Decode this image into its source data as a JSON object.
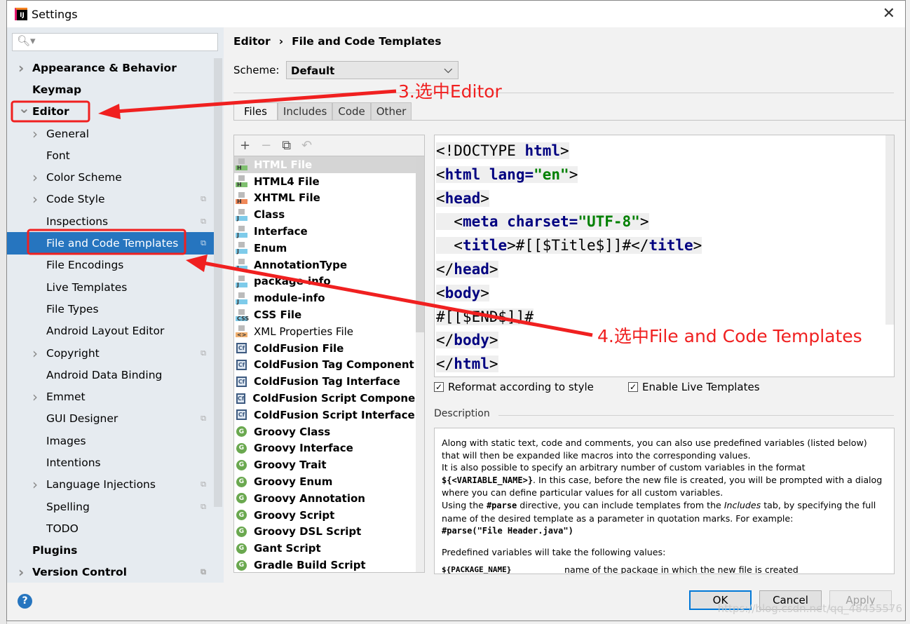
{
  "window": {
    "title": "Settings",
    "app_icon": "IJ"
  },
  "sidebar": {
    "search_placeholder": "",
    "items": [
      {
        "label": "Appearance & Behavior",
        "level": 0,
        "bold": true,
        "chevron": "right"
      },
      {
        "label": "Keymap",
        "level": 0,
        "bold": true
      },
      {
        "label": "Editor",
        "level": 0,
        "bold": true,
        "chevron": "down"
      },
      {
        "label": "General",
        "level": 1,
        "chevron": "right"
      },
      {
        "label": "Font",
        "level": 1
      },
      {
        "label": "Color Scheme",
        "level": 1,
        "chevron": "right"
      },
      {
        "label": "Code Style",
        "level": 1,
        "chevron": "right",
        "project": true
      },
      {
        "label": "Inspections",
        "level": 1,
        "project": true
      },
      {
        "label": "File and Code Templates",
        "level": 1,
        "project": true,
        "selected": true
      },
      {
        "label": "File Encodings",
        "level": 1
      },
      {
        "label": "Live Templates",
        "level": 1
      },
      {
        "label": "File Types",
        "level": 1
      },
      {
        "label": "Android Layout Editor",
        "level": 1
      },
      {
        "label": "Copyright",
        "level": 1,
        "chevron": "right",
        "project": true
      },
      {
        "label": "Android Data Binding",
        "level": 1
      },
      {
        "label": "Emmet",
        "level": 1,
        "chevron": "right"
      },
      {
        "label": "GUI Designer",
        "level": 1,
        "project": true
      },
      {
        "label": "Images",
        "level": 1
      },
      {
        "label": "Intentions",
        "level": 1
      },
      {
        "label": "Language Injections",
        "level": 1,
        "chevron": "right",
        "project": true
      },
      {
        "label": "Spelling",
        "level": 1,
        "project": true
      },
      {
        "label": "TODO",
        "level": 1
      },
      {
        "label": "Plugins",
        "level": 0,
        "bold": true
      },
      {
        "label": "Version Control",
        "level": 0,
        "bold": true,
        "chevron": "right",
        "project": true
      }
    ]
  },
  "breadcrumb": {
    "parent": "Editor",
    "sep": "›",
    "current": "File and Code Templates"
  },
  "scheme": {
    "label": "Scheme:",
    "value": "Default"
  },
  "tabs": [
    "Files",
    "Includes",
    "Code",
    "Other"
  ],
  "active_tab": "Files",
  "toolbar": {
    "add": "+",
    "remove": "−",
    "copy": "⧉",
    "reset": "↶"
  },
  "templates": [
    {
      "label": "HTML File",
      "icon": "html",
      "selected": true
    },
    {
      "label": "HTML4 File",
      "icon": "html"
    },
    {
      "label": "XHTML File",
      "icon": "xhtml"
    },
    {
      "label": "Class",
      "icon": "java"
    },
    {
      "label": "Interface",
      "icon": "java"
    },
    {
      "label": "Enum",
      "icon": "java"
    },
    {
      "label": "AnnotationType",
      "icon": "java"
    },
    {
      "label": "package-info",
      "icon": "java"
    },
    {
      "label": "module-info",
      "icon": "java"
    },
    {
      "label": "CSS File",
      "icon": "css"
    },
    {
      "label": "XML Properties File",
      "icon": "xml",
      "plain": true
    },
    {
      "label": "ColdFusion File",
      "icon": "cf"
    },
    {
      "label": "ColdFusion Tag Component",
      "icon": "cf"
    },
    {
      "label": "ColdFusion Tag Interface",
      "icon": "cf"
    },
    {
      "label": "ColdFusion Script Component",
      "icon": "cf"
    },
    {
      "label": "ColdFusion Script Interface",
      "icon": "cf"
    },
    {
      "label": "Groovy Class",
      "icon": "groovy"
    },
    {
      "label": "Groovy Interface",
      "icon": "groovy"
    },
    {
      "label": "Groovy Trait",
      "icon": "groovy"
    },
    {
      "label": "Groovy Enum",
      "icon": "groovy"
    },
    {
      "label": "Groovy Annotation",
      "icon": "groovy"
    },
    {
      "label": "Groovy Script",
      "icon": "groovy"
    },
    {
      "label": "Groovy DSL Script",
      "icon": "groovy"
    },
    {
      "label": "Gant Script",
      "icon": "groovy"
    },
    {
      "label": "Gradle Build Script",
      "icon": "groovy"
    }
  ],
  "code_lines": [
    [
      [
        "<!DOCTYPE ",
        ""
      ],
      [
        "html",
        "kw"
      ],
      [
        ">",
        ""
      ]
    ],
    [
      [
        "<",
        ""
      ],
      [
        "html",
        "kw"
      ],
      [
        " ",
        ""
      ],
      [
        "lang=",
        "kw"
      ],
      [
        "\"en\"",
        "str"
      ],
      [
        ">",
        ""
      ]
    ],
    [
      [
        "<",
        ""
      ],
      [
        "head",
        "kw"
      ],
      [
        ">",
        ""
      ]
    ],
    [
      [
        "  <",
        ""
      ],
      [
        "meta",
        "kw"
      ],
      [
        " ",
        ""
      ],
      [
        "charset=",
        "kw"
      ],
      [
        "\"UTF-8\"",
        "str"
      ],
      [
        ">",
        ""
      ]
    ],
    [
      [
        "  <",
        ""
      ],
      [
        "title",
        "kw"
      ],
      [
        ">#[[$Title$]]#</",
        ""
      ],
      [
        "title",
        "kw"
      ],
      [
        ">",
        ""
      ]
    ],
    [
      [
        "</",
        ""
      ],
      [
        "head",
        "kw"
      ],
      [
        ">",
        ""
      ]
    ],
    [
      [
        "<",
        ""
      ],
      [
        "body",
        "kw"
      ],
      [
        ">",
        ""
      ]
    ],
    [
      [
        "#[[$END$]]#",
        ""
      ]
    ],
    [
      [
        "</",
        ""
      ],
      [
        "body",
        "kw"
      ],
      [
        ">",
        ""
      ]
    ],
    [
      [
        "</",
        ""
      ],
      [
        "html",
        "kw"
      ],
      [
        ">",
        ""
      ]
    ]
  ],
  "options": {
    "reformat": {
      "label": "Reformat according to style",
      "checked": true
    },
    "live_templates": {
      "label": "Enable Live Templates",
      "checked": true
    }
  },
  "description": {
    "label": "Description",
    "p1": "Along with static text, code and comments, you can also use predefined variables (listed below) that will then be expanded like macros into the corresponding values.",
    "p2a": "It is also possible to specify an arbitrary number of custom variables in the format ",
    "p2code": "${<VARIABLE_NAME>}",
    "p2b": ". In this case, before the new file is created, you will be prompted with a dialog where you can define particular values for all custom variables.",
    "p3a": "Using the ",
    "p3code": "#parse",
    "p3b": " directive, you can include templates from the ",
    "p3i": "Includes",
    "p3c": " tab, by specifying the full name of the desired template as a parameter in quotation marks. For example:",
    "p3ex": "#parse(\"File Header.java\")",
    "p4": "Predefined variables will take the following values:",
    "var_name": "${PACKAGE_NAME}",
    "var_desc": "name of the package in which the new file is created"
  },
  "footer": {
    "help": "?",
    "ok": "OK",
    "cancel": "Cancel",
    "apply": "Apply",
    "watermark": "https://blog.csdn.net/qq_48455576"
  },
  "annotations": {
    "step3": "3.选中Editor",
    "step4": "4.选中File and Code Templates",
    "color": "#f02020"
  }
}
